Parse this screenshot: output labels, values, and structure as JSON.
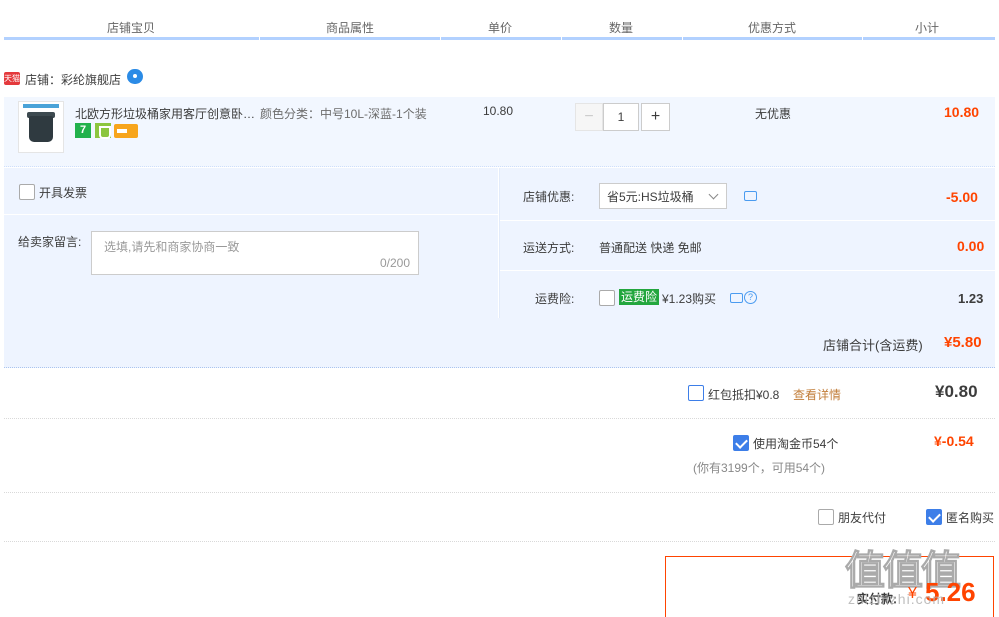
{
  "header": {
    "columns": [
      "店铺宝贝",
      "商品属性",
      "单价",
      "数量",
      "优惠方式",
      "小计"
    ]
  },
  "shop": {
    "badge": "天猫",
    "label": "店铺：彩纶旗舰店"
  },
  "item": {
    "title": "北欧方形垃圾桶家用客厅创意卧…",
    "badge_seven": "7",
    "attributes": "颜色分类：中号10L-深蓝-1个装",
    "unit_price": "10.80",
    "quantity": "1",
    "quantity_minus": "−",
    "quantity_plus": "+",
    "promotion": "无优惠",
    "subtotal": "10.80"
  },
  "options": {
    "invoice_label": "开具发票",
    "message_label": "给卖家留言:",
    "message_placeholder": "选填,请先和商家协商一致",
    "message_count": "0/200",
    "shop_coupon_label": "店铺优惠:",
    "shop_coupon_value": "省5元:HS垃圾桶",
    "shop_coupon_amount": "-5.00",
    "shipping_label": "运送方式:",
    "shipping_value": "普通配送 快递 免邮",
    "shipping_amount": "0.00",
    "insurance_label": "运费险:",
    "insurance_badge": "运费险",
    "insurance_price": "¥1.23购买",
    "insurance_amount": "1.23",
    "insurance_help": "?"
  },
  "shop_total": {
    "label": "店铺合计(含运费)",
    "value": "¥5.80"
  },
  "red_packet": {
    "label": "红包抵扣¥0.8",
    "link": "查看详情",
    "value": "¥0.80"
  },
  "tao_coins": {
    "label": "使用淘金币54个",
    "note": "(你有3199个，可用54个)",
    "value": "¥-0.54"
  },
  "extras": {
    "friend_pay": "朋友代付",
    "anonymous": "匿名购买"
  },
  "payment": {
    "label": "实付款:",
    "currency": "¥",
    "value": "5.26"
  },
  "watermark": {
    "main": "值值值",
    "sub": "zhizhizhi.com"
  },
  "colors": {
    "accent_red": "#ff4400",
    "check_blue": "#3d7ee8",
    "header_line": "#b2d1ff",
    "row_bg": "#eef4ff"
  }
}
